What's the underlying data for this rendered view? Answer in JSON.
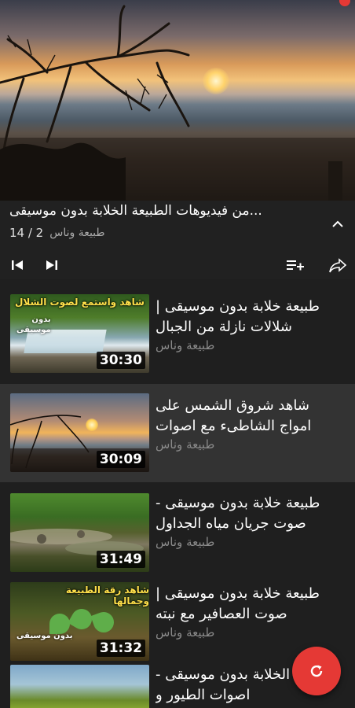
{
  "playlist": {
    "title": "...من فيديوهات الطبيعة الخلابة بدون موسيقى",
    "channel": "طبيعة وناس",
    "position": "14 / 2"
  },
  "videos": [
    {
      "title": "طبيعة خلابة بدون موسيقى | شلالات نازلة من الجبال",
      "channel": "طبيعة وناس",
      "duration": "30:30",
      "thumb_caption": "شاهد واستمع لصوت الشلال",
      "thumb_sub": "بدون\nموسيقى",
      "active": false
    },
    {
      "title": "شاهد شروق الشمس على امواج الشاطىء مع اصوات",
      "channel": "طبيعة وناس",
      "duration": "30:09",
      "active": true
    },
    {
      "title": "طبيعة خلابة بدون موسيقى - صوت جريان مياه الجداول",
      "channel": "طبيعة وناس",
      "duration": "31:49",
      "active": false
    },
    {
      "title": "طبيعة خلابة بدون موسيقى | صوت العصافير مع نبته",
      "channel": "طبيعة وناس",
      "duration": "31:32",
      "thumb_caption": "شاهد رقة الطبيعة وجمالها",
      "thumb_sub": "بدون\nموسيقى",
      "active": false
    },
    {
      "title": "الطبيعة الخلابة بدون موسيقى - اصوات الطيور و",
      "channel": "",
      "duration": "",
      "active": false
    }
  ],
  "colors": {
    "background": "#1f1f1f",
    "active_row": "#333333",
    "accent": "#e53935",
    "caption_yellow": "#ffe04a"
  },
  "icons": [
    "previous-icon",
    "next-icon",
    "add-to-queue-icon",
    "share-icon",
    "chevron-up-icon",
    "refresh-icon"
  ]
}
